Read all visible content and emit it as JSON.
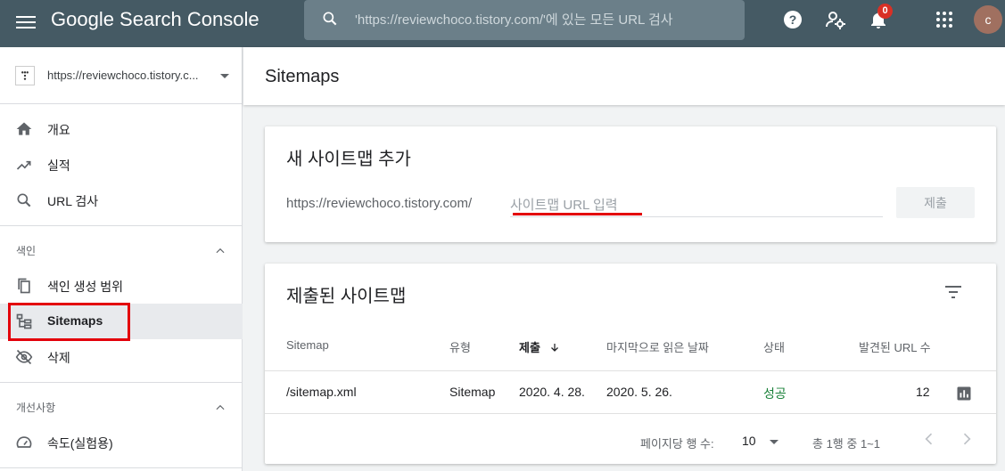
{
  "app": {
    "title": "Google Search Console"
  },
  "search": {
    "placeholder": "'https://reviewchoco.tistory.com/'에 있는 모든 URL 검사"
  },
  "notifications": {
    "count": "0"
  },
  "user": {
    "initial": "c"
  },
  "property": {
    "url": "https://reviewchoco.tistory.c..."
  },
  "sidebar": {
    "items": [
      {
        "label": "개요",
        "icon": "home-icon"
      },
      {
        "label": "실적",
        "icon": "trending-up-icon"
      },
      {
        "label": "URL 검사",
        "icon": "search-icon"
      }
    ],
    "index_section": {
      "label": "색인"
    },
    "index_items": [
      {
        "label": "색인 생성 범위",
        "icon": "copy-icon"
      },
      {
        "label": "Sitemaps",
        "icon": "sitemap-icon",
        "active": true
      },
      {
        "label": "삭제",
        "icon": "visibility-off-icon"
      }
    ],
    "enhance_section": {
      "label": "개선사항"
    },
    "enhance_items": [
      {
        "label": "속도(실험용)",
        "icon": "speed-icon"
      }
    ]
  },
  "page": {
    "title": "Sitemaps"
  },
  "add_card": {
    "title": "새 사이트맵 추가",
    "prefix": "https://reviewchoco.tistory.com/",
    "placeholder": "사이트맵 URL 입력",
    "submit_label": "제출"
  },
  "list_card": {
    "title": "제출된 사이트맵",
    "columns": [
      "Sitemap",
      "유형",
      "제출",
      "마지막으로 읽은 날짜",
      "상태",
      "발견된 URL 수"
    ],
    "rows": [
      {
        "sitemap": "/sitemap.xml",
        "type": "Sitemap",
        "submitted": "2020. 4. 28.",
        "last_read": "2020. 5. 26.",
        "status": "성공",
        "urls": "12"
      }
    ],
    "pagination": {
      "rows_label": "페이지당 행 수:",
      "rows_value": "10",
      "range": "총 1행 중 1~1"
    }
  },
  "colors": {
    "topbar": "#455a64",
    "success": "#188038",
    "highlight": "#e3000b"
  }
}
